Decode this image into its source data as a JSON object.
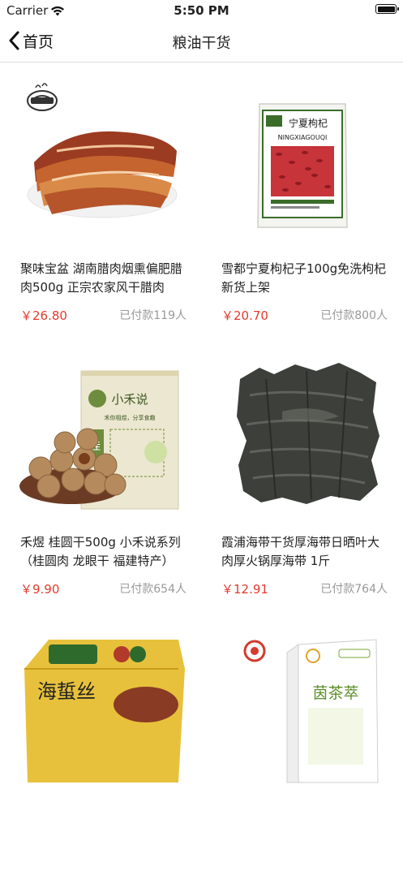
{
  "status_bar": {
    "carrier": "Carrier",
    "time": "5:50 PM"
  },
  "nav": {
    "back_label": "首页",
    "title": "粮油干货"
  },
  "products": [
    {
      "name": "聚味宝盆 湖南腊肉烟熏偏肥腊肉500g 正宗农家风干腊肉",
      "price": "￥26.80",
      "sold": "已付款119人",
      "image": "bacon"
    },
    {
      "name": "雪都宁夏枸杞子100g免洗枸杞新货上架",
      "price": "￥20.70",
      "sold": "已付款800人",
      "image": "goji-bag"
    },
    {
      "name": "禾煜 桂圆干500g 小禾说系列（桂圆肉 龙眼干 福建特产）",
      "price": "￥9.90",
      "sold": "已付款654人",
      "image": "longan-bag"
    },
    {
      "name": "霞浦海带干货厚海带日晒叶大肉厚火锅厚海带 1斤",
      "price": "￥12.91",
      "sold": "已付款764人",
      "image": "kelp"
    },
    {
      "name": "",
      "price": "",
      "sold": "",
      "image": "seaweed-box"
    },
    {
      "name": "",
      "price": "",
      "sold": "",
      "image": "tea-box"
    }
  ],
  "image_text": {
    "goji_title": "宁夏枸杞",
    "goji_sub": "NINGXIAGOUQI",
    "longan_brand": "小禾说",
    "longan_slogan": "禾你相煜，分享食趣",
    "longan_char": "桂",
    "seaweed_text": "海蜇丝",
    "tea_text": "茵茶萃"
  },
  "colors": {
    "price": "#e23b2e",
    "sold": "#999999",
    "divider": "#dcdcdc"
  }
}
